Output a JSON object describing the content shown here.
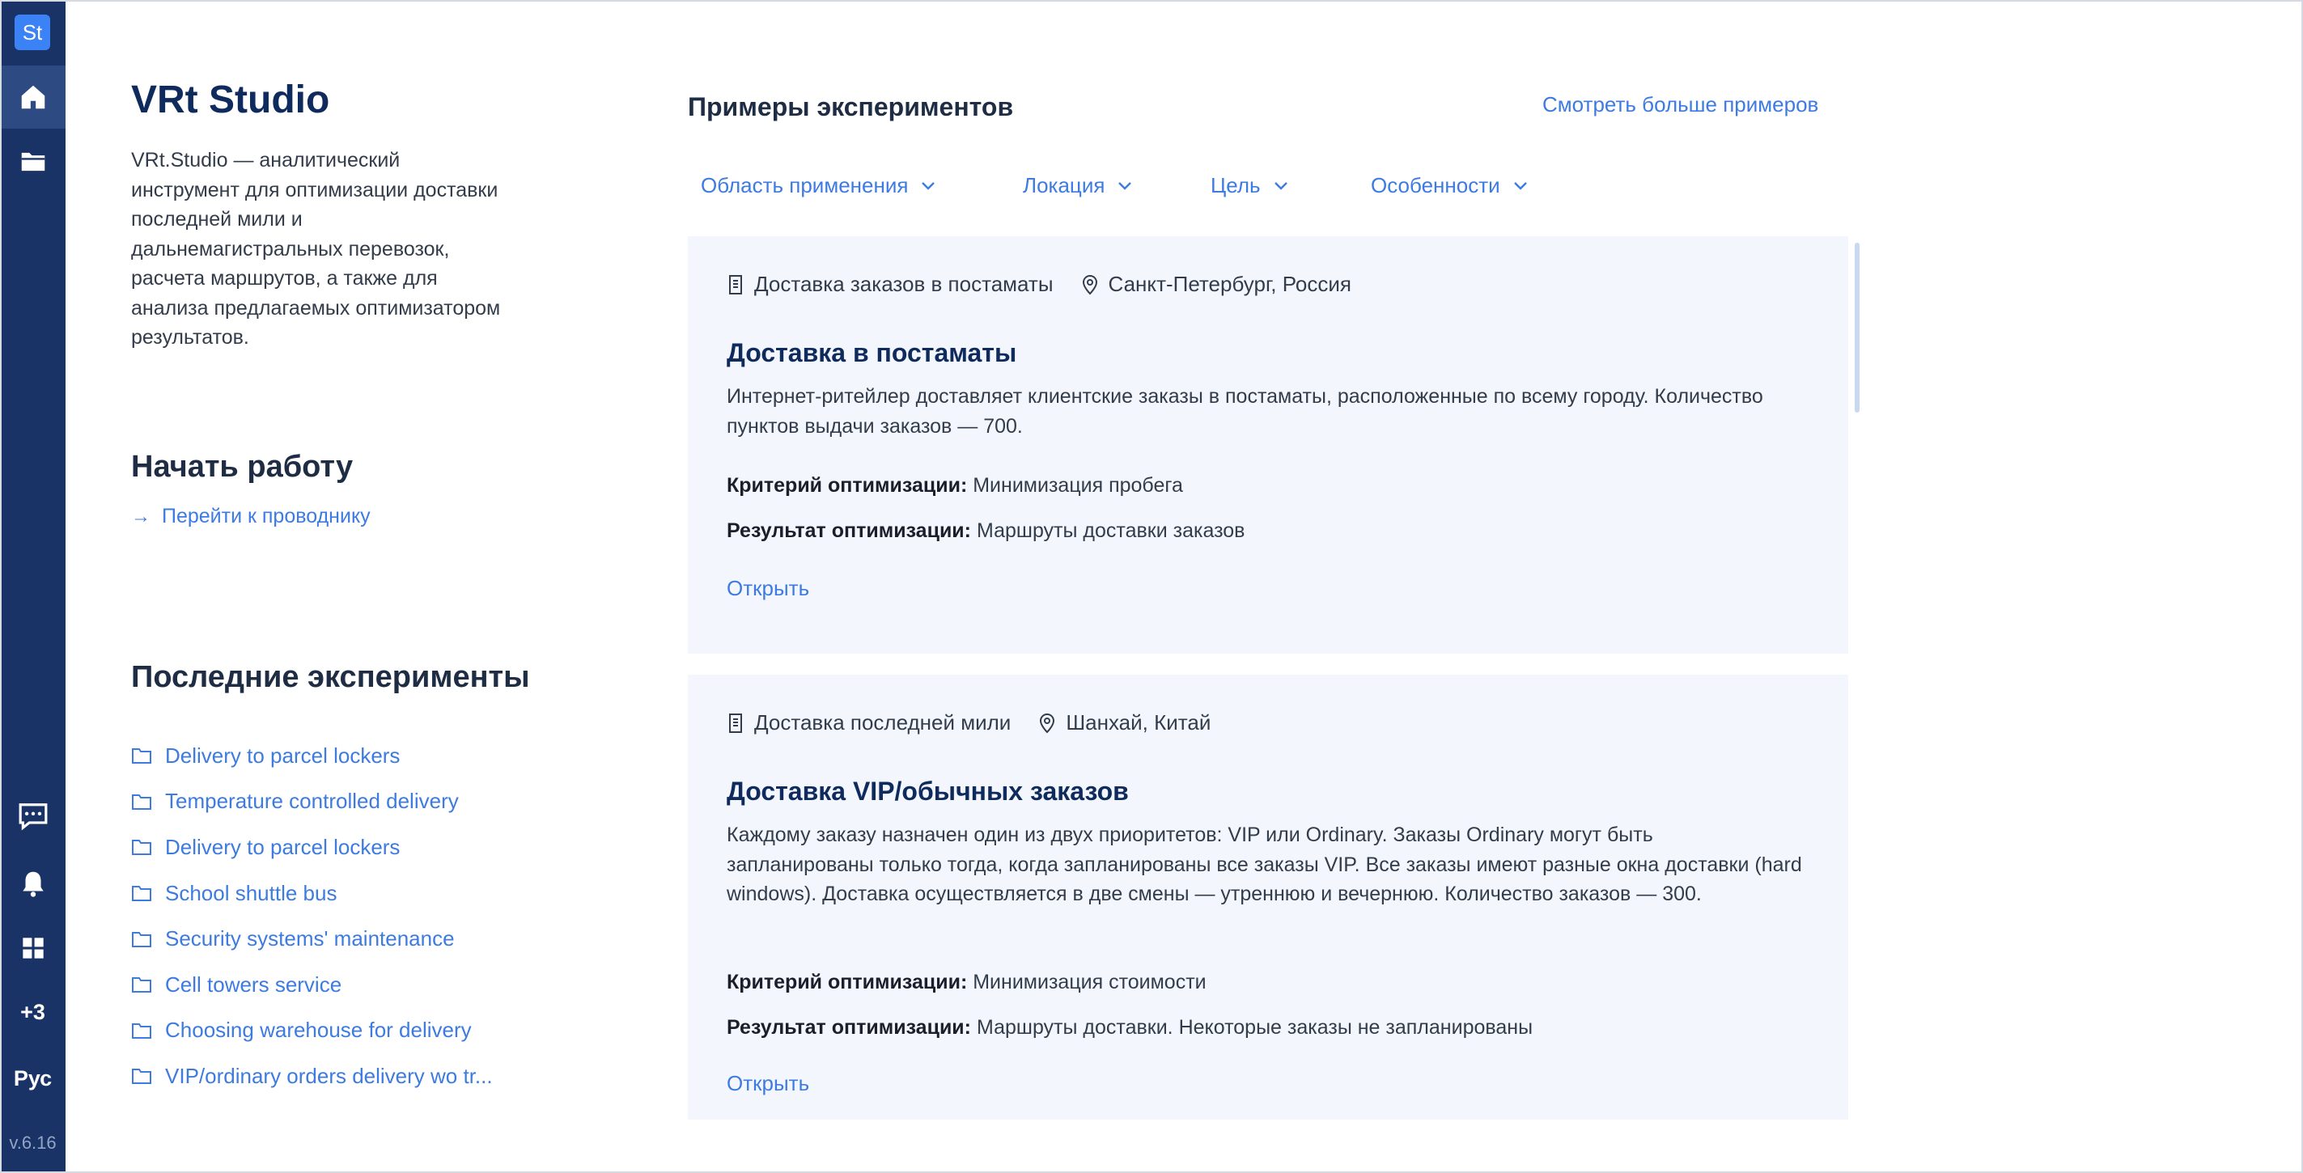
{
  "sidebar": {
    "logo": "St",
    "plus_count": "+3",
    "language": "Рус",
    "version": "v.6.16",
    "icons": [
      "home-icon",
      "folder-icon",
      "chat-icon",
      "bell-icon",
      "apps-grid-icon"
    ]
  },
  "intro": {
    "title": "VRt Studio",
    "description": "VRt.Studio — аналитический инструмент для оптимизации доставки последней мили и дальнемагистральных перевозок, расчета маршрутов, а также для анализа предлагаемых оптимизатором результатов."
  },
  "start": {
    "heading": "Начать работу",
    "guide_link": "Перейти к проводнику"
  },
  "recent": {
    "heading": "Последние эксперименты",
    "items": [
      "Delivery to parcel lockers",
      "Temperature controlled delivery",
      "Delivery to parcel lockers",
      "School shuttle bus",
      "Security systems' maintenance",
      "Cell towers service",
      "Choosing warehouse for delivery",
      "VIP/ordinary orders delivery wo tr..."
    ]
  },
  "examples": {
    "heading": "Примеры экспериментов",
    "more_link": "Смотреть больше примеров",
    "filters": [
      "Область применения",
      "Локация",
      "Цель",
      "Особенности"
    ],
    "cards": [
      {
        "category": "Доставка заказов в постаматы",
        "location": "Санкт-Петербург, Россия",
        "title": "Доставка в постаматы",
        "description": "Интернет-ритейлер доставляет клиентские заказы в постаматы, расположенные по всему городу. Количество пунктов выдачи заказов — 700.",
        "criterion_label": "Критерий оптимизации:",
        "criterion": "Минимизация пробега",
        "result_label": "Результат оптимизации:",
        "result": "Маршруты доставки заказов",
        "open": "Открыть"
      },
      {
        "category": "Доставка последней мили",
        "location": "Шанхай, Китай",
        "title": "Доставка VIP/обычных заказов",
        "description": "Каждому заказу назначен один из двух приоритетов: VIP или Ordinary. Заказы Ordinary могут быть запланированы только тогда, когда запланированы все заказы VIP. Все заказы имеют разные окна доставки (hard windows). Доставка осуществляется в две смены — утреннюю и вечернюю. Количество заказов — 300.",
        "criterion_label": "Критерий оптимизации:",
        "criterion": "Минимизация стоимости",
        "result_label": "Результат оптимизации:",
        "result": "Маршруты доставки. Некоторые заказы не запланированы",
        "open": "Открыть"
      }
    ]
  },
  "colors": {
    "sidebar_bg": "#1a3366",
    "accent": "#3d7be0",
    "card_bg": "#f3f7fd",
    "title": "#0f2a5c"
  }
}
